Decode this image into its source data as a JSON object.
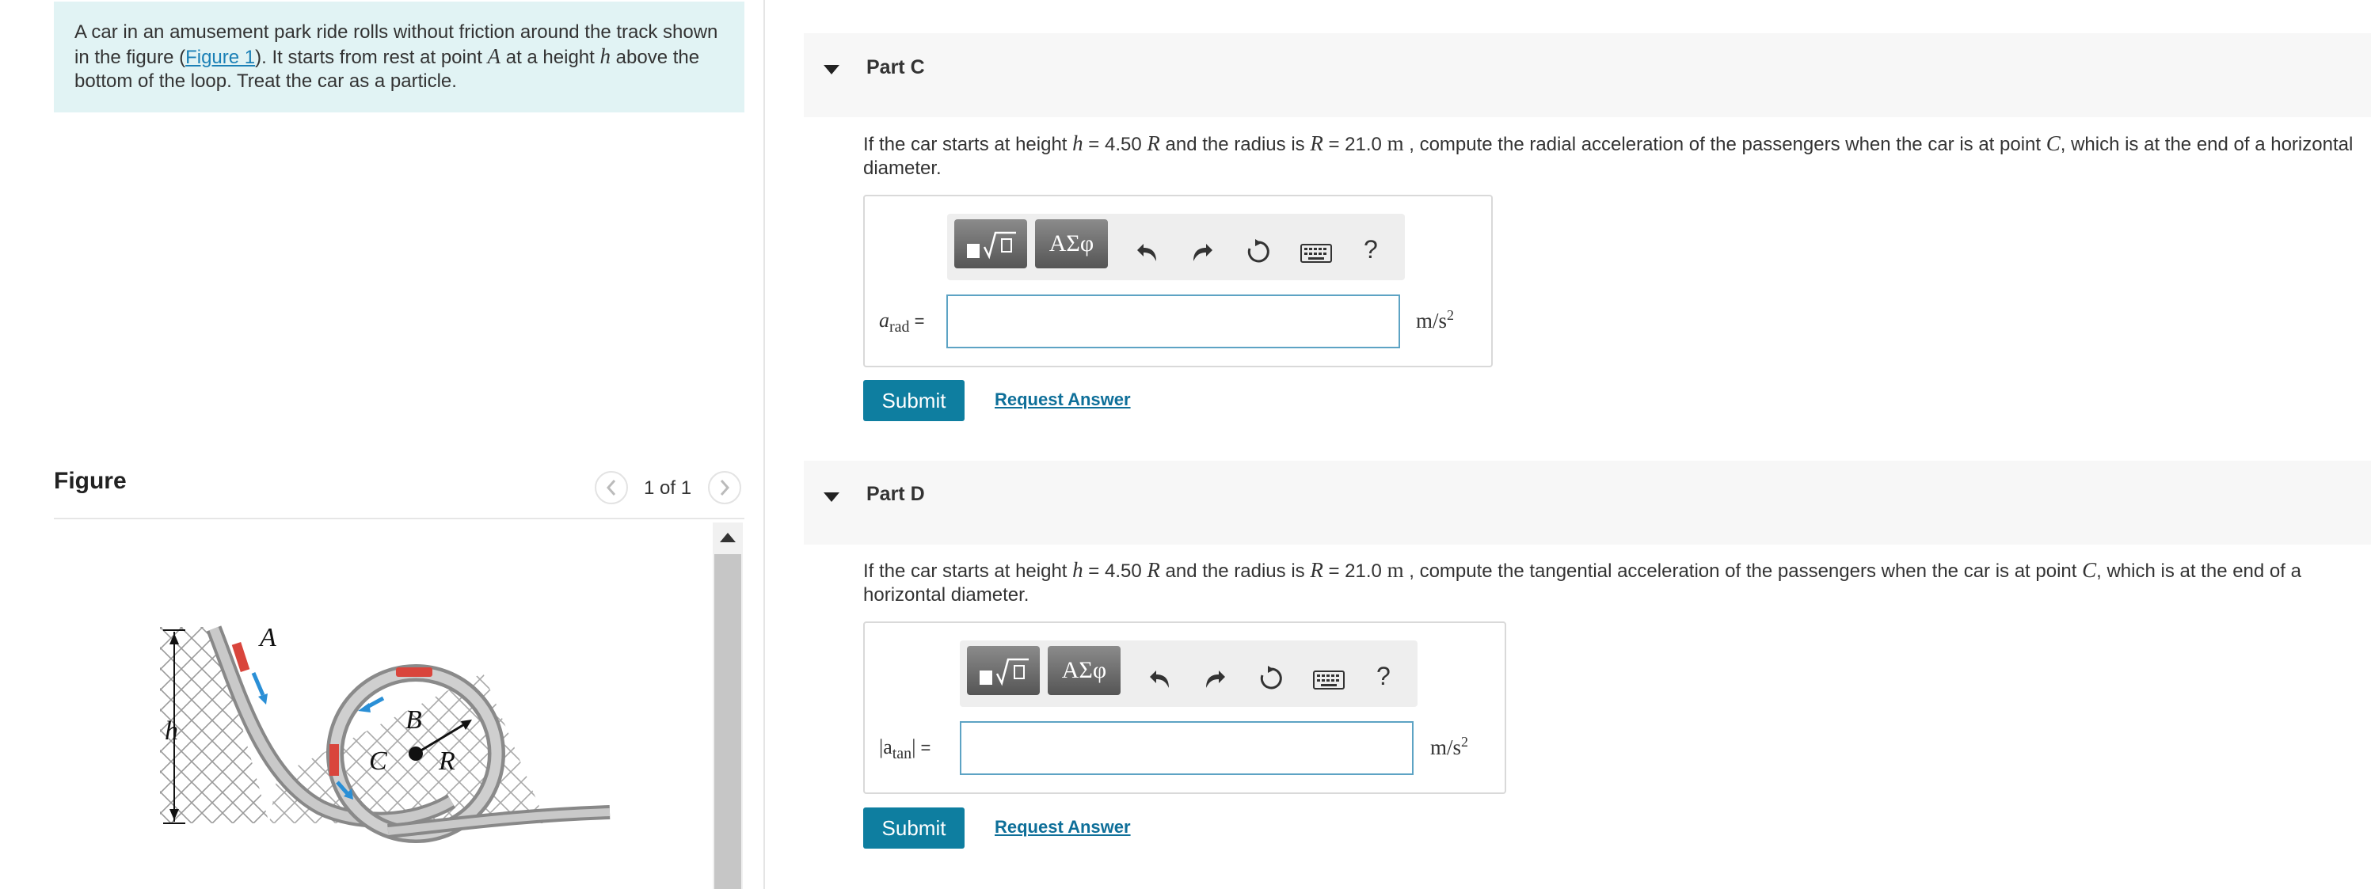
{
  "intro": {
    "text_1": "A car in an amusement park ride rolls without friction around the track shown in the figure (",
    "figure_link": "Figure 1",
    "text_2": "). It starts from rest at point ",
    "point": "A",
    "text_3": " at a height ",
    "height_var": "h",
    "text_4": " above the bottom of the loop. Treat the car as a particle."
  },
  "figure_panel": {
    "title": "Figure",
    "pager": "1 of 1",
    "labels": {
      "A": "A",
      "B": "B",
      "C": "C",
      "R": "R",
      "h": "h"
    }
  },
  "parts": [
    {
      "label": "Part C",
      "q_1": "If the car starts at height ",
      "q_h": "h",
      "q_eq": " = 4.50 ",
      "q_R1": "R",
      "q_2": " and the radius is ",
      "q_R2": "R",
      "q_3": " = 21.0 ",
      "q_unit": "m",
      "q_4": " , compute the radial acceleration of the passengers when the car is at point ",
      "q_C": "C",
      "q_5": ", which is at the end of a horizontal diameter.",
      "var": "a",
      "var_sub": "rad",
      "var_eq": " =",
      "unit": "m/s",
      "unit_exp": "2",
      "submit": "Submit",
      "request": "Request Answer"
    },
    {
      "label": "Part D",
      "q_1": "If the car starts at height ",
      "q_h": "h",
      "q_eq": " =  4.50 ",
      "q_R1": "R",
      "q_2": " and the radius is ",
      "q_R2": "R",
      "q_3": " = 21.0 ",
      "q_unit": "m",
      "q_4": " , compute the tangential acceleration of the passengers when the car is at point ",
      "q_C": "C",
      "q_5": ", which is at the end of a horizontal diameter.",
      "var": "|a",
      "var_sub": "tan",
      "var_end": "|",
      "var_eq": " =",
      "unit": "m/s",
      "unit_exp": "2",
      "submit": "Submit",
      "request": "Request Answer"
    }
  ],
  "toolbar": {
    "templates_icon": "fraction-sqrt-templates-icon",
    "symbols_label": "ΑΣφ",
    "undo_icon": "undo-icon",
    "redo_icon": "redo-icon",
    "reset_icon": "reset-icon",
    "keyboard_icon": "keyboard-icon",
    "help_label": "?"
  },
  "colors": {
    "intro_bg": "#e1f3f4",
    "submit_bg": "#0e7ea0",
    "link": "#1b80b6",
    "input_border": "#5da3c4",
    "car_red": "#d9453c",
    "arrow_blue": "#2a8fd6"
  }
}
